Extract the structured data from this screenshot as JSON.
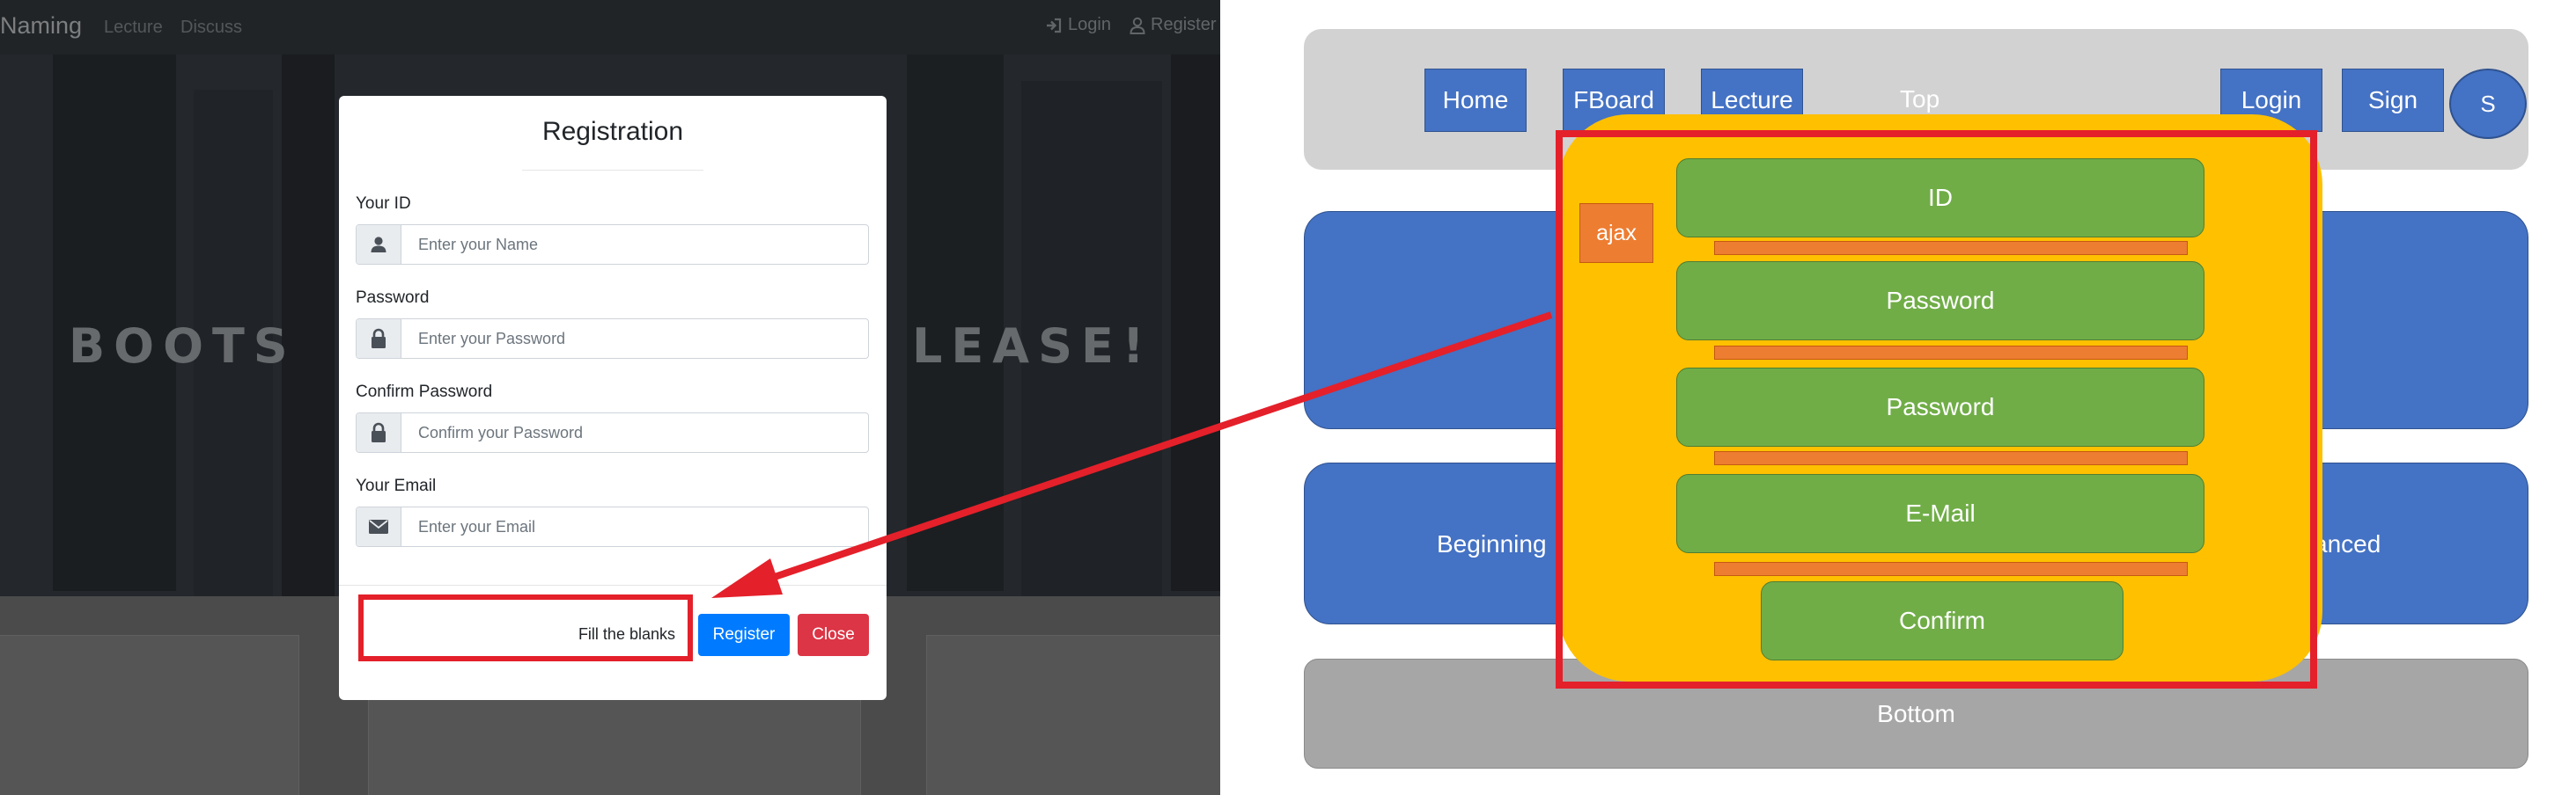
{
  "screenshot": {
    "nav": {
      "brand": "Naming",
      "links": [
        "Lecture",
        "Discuss"
      ],
      "login": "Login",
      "register": "Register",
      "login_icon": "sign-in-icon",
      "register_icon": "user-icon"
    },
    "hero": {
      "left_text": "BOOTS",
      "right_text": "LEASE!"
    },
    "modal": {
      "title": "Registration",
      "fields": [
        {
          "label": "Your ID",
          "placeholder": "Enter your Name",
          "icon": "user-icon"
        },
        {
          "label": "Password",
          "placeholder": "Enter your Password",
          "icon": "lock-icon"
        },
        {
          "label": "Confirm Password",
          "placeholder": "Confirm your Password",
          "icon": "lock-icon"
        },
        {
          "label": "Your Email",
          "placeholder": "Enter your Email",
          "icon": "envelope-icon"
        }
      ],
      "message": "Fill the blanks",
      "register_button": "Register",
      "close_button": "Close"
    }
  },
  "wireframe": {
    "top_buttons": [
      "Home",
      "FBoard",
      "Lecture"
    ],
    "top_label": "Top",
    "right_buttons": [
      "Login",
      "Sign"
    ],
    "circle": "S",
    "beginning": "Beginning",
    "advanced_partial": "anced",
    "bottom": "Bottom",
    "popup": {
      "ajax": "ajax",
      "fields": [
        "ID",
        "Password",
        "Password",
        "E-Mail"
      ],
      "confirm": "Confirm"
    }
  },
  "colors": {
    "highlight_red": "#e4202a",
    "primary_blue": "#007bff",
    "danger_red": "#dc3545",
    "wireframe_blue": "#4472c4",
    "popup_yellow": "#ffc000",
    "green": "#70ad47",
    "orange": "#ed7d31"
  }
}
